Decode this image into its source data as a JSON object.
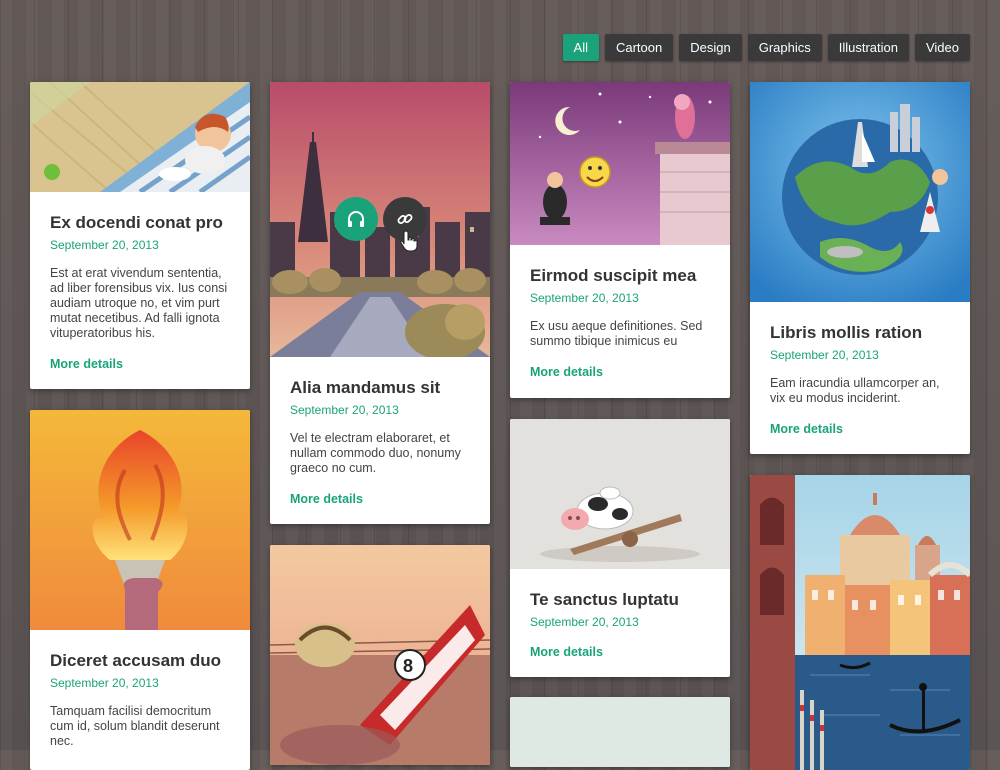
{
  "filters": [
    {
      "label": "All",
      "active": true
    },
    {
      "label": "Cartoon"
    },
    {
      "label": "Design"
    },
    {
      "label": "Graphics"
    },
    {
      "label": "Illustration"
    },
    {
      "label": "Video"
    }
  ],
  "cards": [
    {
      "title": "Ex docendi conat pro",
      "date": "September 20, 2013",
      "desc": "Est at erat vivendum sententia, ad liber forensibus vix. Ius consi audiam utroque no, et vim purt mutat necetibus. Ad falli ignota vituperatoribus his.",
      "more": "More details"
    },
    {
      "title": "Alia mandamus sit",
      "date": "September 20, 2013",
      "desc": "Vel te electram elaboraret, et nullam commodo duo, nonumy graeco no cum.",
      "more": "More details"
    },
    {
      "title": "Eirmod suscipit mea",
      "date": "September 20, 2013",
      "desc": "Ex usu aeque definitiones. Sed summo tibique inimicus eu",
      "more": "More details"
    },
    {
      "title": "Libris mollis ration",
      "date": "September 20, 2013",
      "desc": "Eam iracundia ullamcorper an, vix eu modus inciderint.",
      "more": "More details"
    },
    {
      "title": "Diceret accusam duo",
      "date": "September 20, 2013",
      "desc": "Tamquam facilisi democritum cum id, solum blandit deserunt nec."
    },
    {
      "title": "Te sanctus luptatu",
      "date": "September 20, 2013",
      "more": "More details"
    }
  ],
  "icons": {
    "accent": "#1aa37a",
    "overlay_left": "headphones-icon",
    "overlay_right": "link-icon",
    "cursor": "hand-pointer-icon"
  }
}
